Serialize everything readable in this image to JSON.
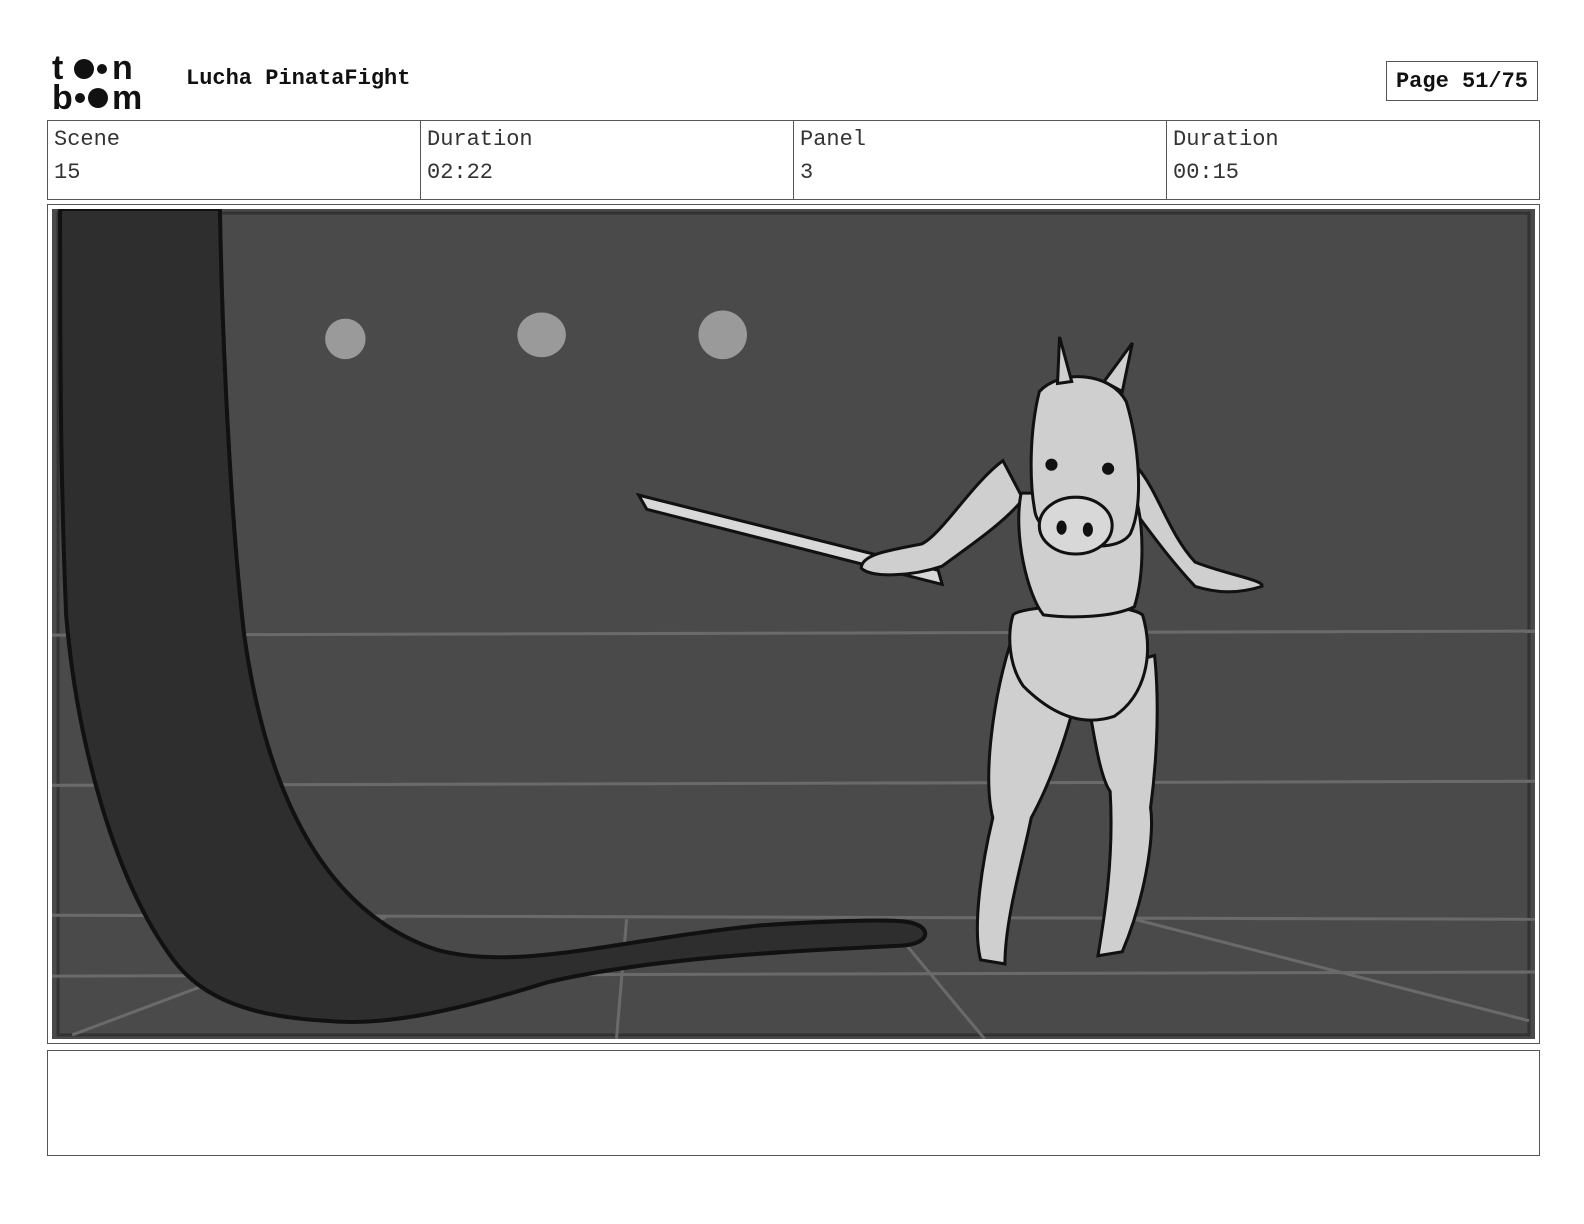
{
  "header": {
    "logo_text": "toon boom",
    "project_title": "Lucha PinataFight",
    "page_label": "Page 51/75"
  },
  "info": [
    {
      "label": "Scene",
      "value": "15"
    },
    {
      "label": "Duration",
      "value": "02:22"
    },
    {
      "label": "Panel",
      "value": "3"
    },
    {
      "label": "Duration",
      "value": "00:15"
    }
  ],
  "panel": {
    "icon": "storyboard-sketch",
    "background_color": "#4a4a4a"
  },
  "caption": {
    "text": ""
  }
}
